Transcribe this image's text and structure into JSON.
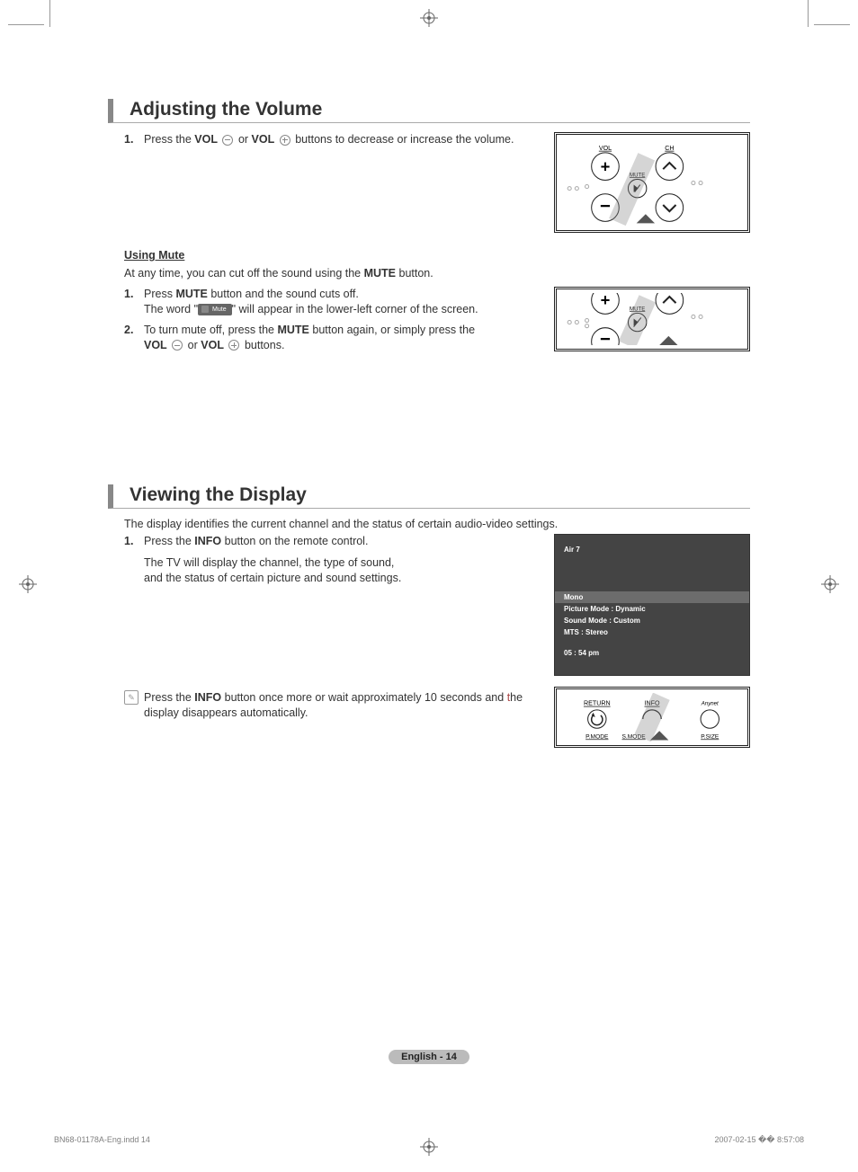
{
  "section1": {
    "title": "Adjusting the Volume",
    "step1_a": "Press the ",
    "step1_vol1": "VOL",
    "step1_b": " or ",
    "step1_vol2": "VOL",
    "step1_c": " buttons to decrease or increase the volume."
  },
  "mute": {
    "heading": "Using Mute",
    "intro_a": "At any time, you can cut off the sound using the ",
    "intro_mute": "MUTE",
    "intro_b": " button.",
    "step1_a": "Press ",
    "step1_mute": "MUTE",
    "step1_b": " button and the sound cuts off.",
    "step1_c": "The word \"",
    "step1_tag": "Mute",
    "step1_d": "\" will appear in the lower-left corner of the screen.",
    "step2_a": "To turn mute off, press the ",
    "step2_mute": "MUTE",
    "step2_b": " button again, or simply press the",
    "step2_vol1": "VOL",
    "step2_c": " or ",
    "step2_vol2": "VOL",
    "step2_d": " buttons."
  },
  "section2": {
    "title": "Viewing the Display",
    "intro": "The display identifies the current channel and the status of certain audio-video settings.",
    "step1_a": "Press the ",
    "step1_info": "INFO",
    "step1_b": " button on the remote control.",
    "step1_sub1": "The TV will display the channel, the type of sound,",
    "step1_sub2": "and the status of certain picture and sound settings.",
    "note_a": "Press the ",
    "note_info": "INFO",
    "note_b": " button once more or wait approximately 10 seconds and ",
    "note_c": "t",
    "note_d": "he display disappears automatically."
  },
  "osd": {
    "channel": "Air 7",
    "mono": "Mono",
    "picture": "Picture Mode : Dynamic",
    "sound": "Sound Mode : Custom",
    "mts": "MTS : Stereo",
    "time": "05 : 54 pm"
  },
  "remote_info": {
    "return": "RETURN",
    "info": "INFO",
    "anynet": "Anynet",
    "pmode": "P.MODE",
    "smode": "S.MODE",
    "psize": "P.SIZE"
  },
  "remote_vol": {
    "vol": "VOL",
    "ch": "CH",
    "mute": "MUTE"
  },
  "footer": {
    "label": "English - 14",
    "file": "BN68-01178A-Eng.indd   14",
    "date": "2007-02-15   �� 8:57:08"
  }
}
